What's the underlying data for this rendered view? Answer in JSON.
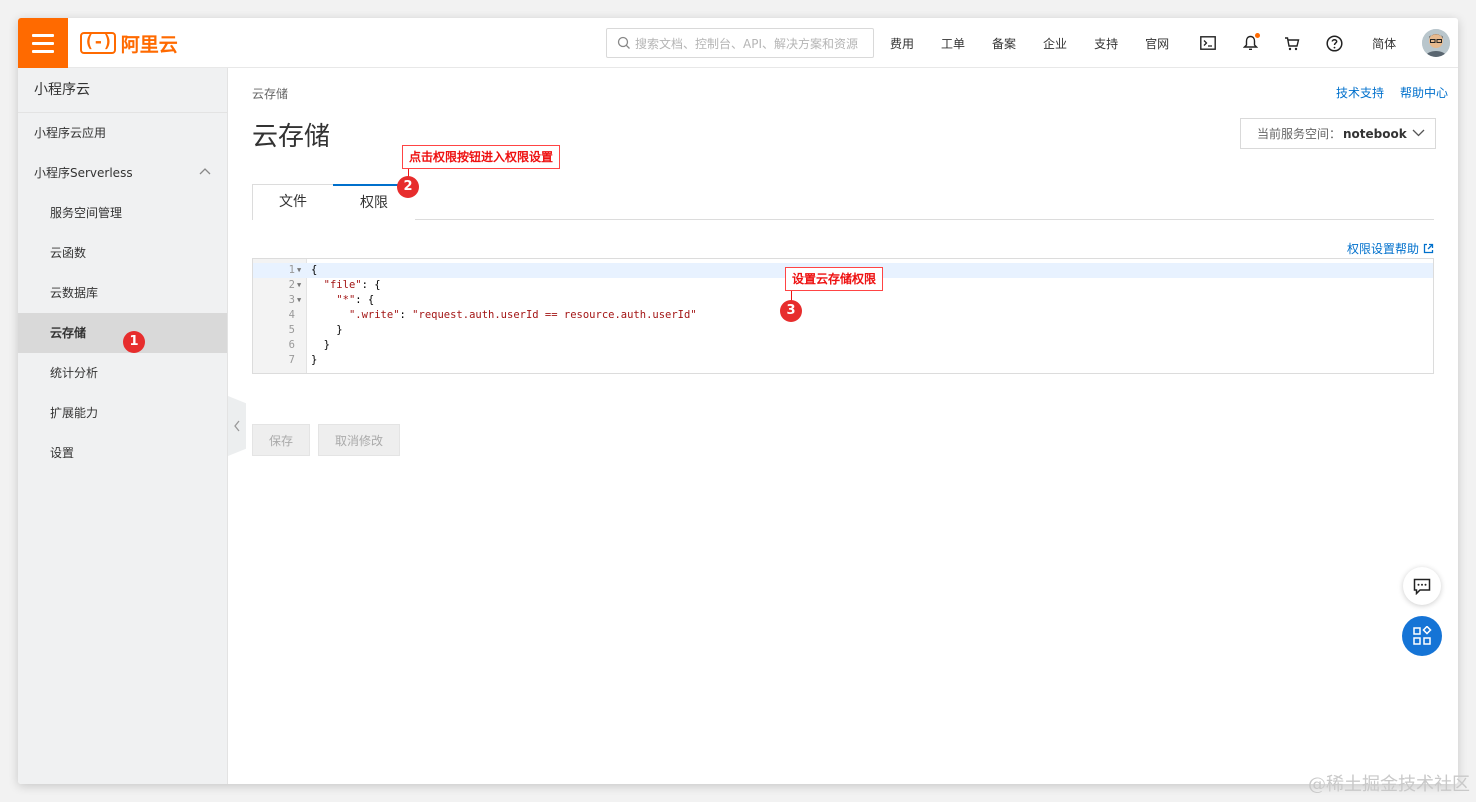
{
  "header": {
    "brand": "阿里云",
    "brand_mark": "(-)",
    "search_placeholder": "搜索文档、控制台、API、解决方案和资源",
    "nav_links": [
      "费用",
      "工单",
      "备案",
      "企业",
      "支持",
      "官网"
    ],
    "language": "简体",
    "accent_color": "#ff6a00"
  },
  "sidebar": {
    "title": "小程序云",
    "items": [
      {
        "label": "小程序云应用"
      },
      {
        "label": "小程序Serverless"
      },
      {
        "label": "服务空间管理"
      },
      {
        "label": "云函数"
      },
      {
        "label": "云数据库"
      },
      {
        "label": "云存储"
      },
      {
        "label": "统计分析"
      },
      {
        "label": "扩展能力"
      },
      {
        "label": "设置"
      }
    ]
  },
  "main": {
    "breadcrumb": "云存储",
    "top_links": [
      "技术支持",
      "帮助中心"
    ],
    "page_title": "云存储",
    "space_label": "当前服务空间：",
    "space_value": "notebook",
    "tabs": [
      "文件",
      "权限"
    ],
    "help_link": "权限设置帮助",
    "editor_lines": {
      "l1": "{",
      "l2_key": "\"file\"",
      "l2_rest": ": {",
      "l3_key": "\"*\"",
      "l3_rest": ": {",
      "l4_key": "\".write\"",
      "l4_sep": ": ",
      "l4_val": "\"request.auth.userId == resource.auth.userId\"",
      "l5": "}",
      "l6": "}",
      "l7": "}"
    },
    "line_numbers": [
      "1",
      "2",
      "3",
      "4",
      "5",
      "6",
      "7"
    ],
    "buttons": {
      "save": "保存",
      "cancel": "取消修改"
    }
  },
  "annotations": {
    "callout_tab": "点击权限按钮进入权限设置",
    "callout_editor": "设置云存储权限",
    "badges": [
      "1",
      "2",
      "3"
    ],
    "color": "#e72d2d"
  },
  "watermark": "@稀土掘金技术社区"
}
